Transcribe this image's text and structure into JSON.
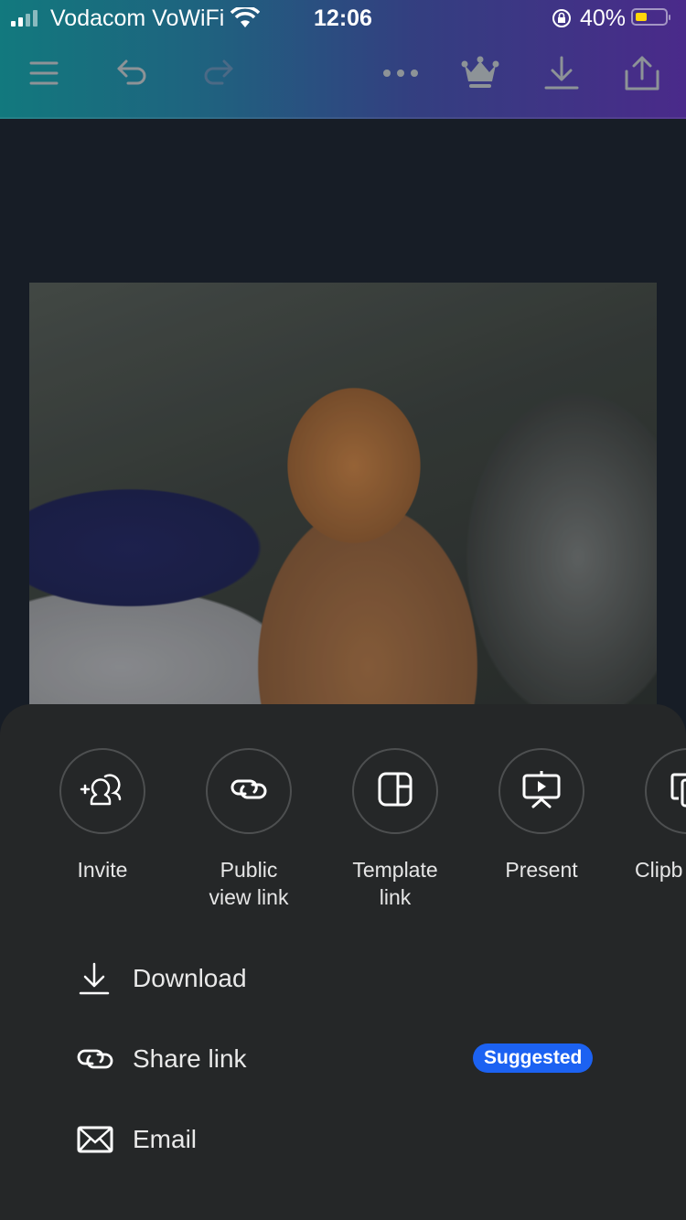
{
  "status_bar": {
    "carrier": "Vodacom VoWiFi",
    "time": "12:06",
    "battery_percent": "40%",
    "battery_level": 0.4,
    "icons": [
      "signal-icon",
      "wifi-icon",
      "rotation-lock-icon",
      "battery-icon"
    ]
  },
  "toolbar": {
    "gradient_start": "#12797e",
    "gradient_end": "#4a2a8a",
    "items": [
      {
        "name": "menu",
        "icon": "hamburger-menu-icon"
      },
      {
        "name": "undo",
        "icon": "undo-icon"
      },
      {
        "name": "redo",
        "icon": "redo-icon",
        "disabled": true
      },
      {
        "name": "more",
        "icon": "more-dots-icon"
      },
      {
        "name": "premium",
        "icon": "crown-icon"
      },
      {
        "name": "download",
        "icon": "download-icon"
      },
      {
        "name": "share",
        "icon": "share-icon"
      }
    ]
  },
  "canvas": {
    "background": "#171d26",
    "image_description": "orange kitten on bed sheets"
  },
  "share_sheet": {
    "background": "#252728",
    "actions": [
      {
        "label": "Invite",
        "icon": "invite-people-icon"
      },
      {
        "label": "Public\nview link",
        "icon": "link-icon"
      },
      {
        "label": "Template\nlink",
        "icon": "template-icon"
      },
      {
        "label": "Present",
        "icon": "present-icon"
      },
      {
        "label": "Clipb",
        "icon": "clipboard-icon"
      }
    ],
    "list": [
      {
        "label": "Download",
        "icon": "download-icon"
      },
      {
        "label": "Share link",
        "icon": "link-icon",
        "badge": "Suggested",
        "badge_color": "#1c62f2"
      },
      {
        "label": "Email",
        "icon": "email-icon"
      }
    ]
  }
}
